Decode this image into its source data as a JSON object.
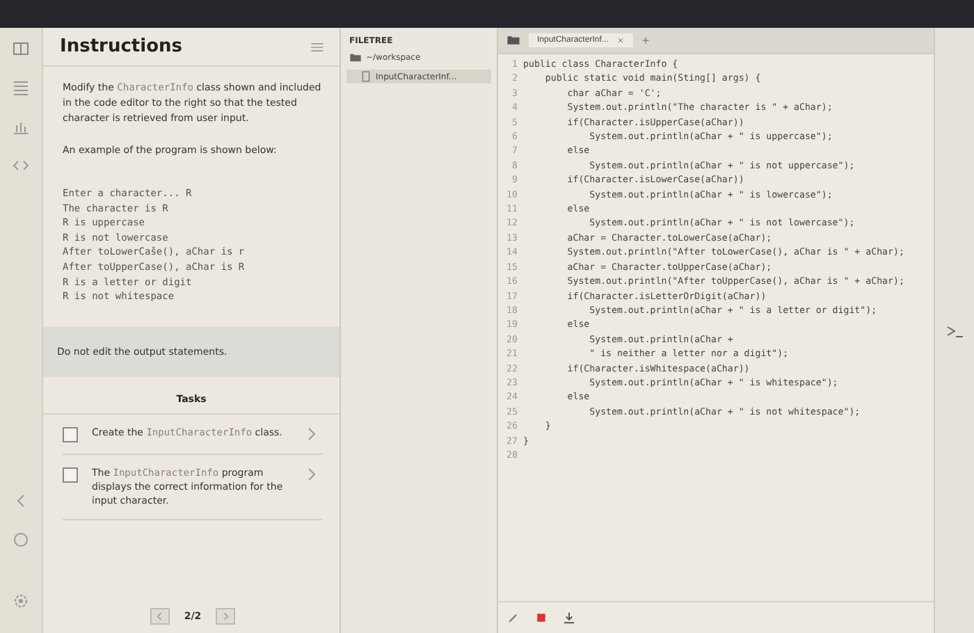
{
  "instructions": {
    "title": "Instructions",
    "paragraphs": [
      [
        {
          "text": "Modify the "
        },
        {
          "text": "CharacterInfo",
          "kind": "code"
        },
        {
          "text": " class shown and included in the code editor to the right so that the tested character is retrieved from user input."
        }
      ],
      [
        {
          "text": "An example of the program is shown below:"
        }
      ]
    ],
    "output_example": [
      "Enter a character... R",
      "The character is R",
      "R is uppercase",
      "R is not lowercase",
      "After toLowerCaše(), aChar is r",
      "After toUpperCase(), aChar is R",
      "R is a letter or digit",
      "R is not whitespace"
    ],
    "note": "Do not edit the output statements.",
    "tasks_title": "Tasks",
    "tasks": [
      {
        "checked": false,
        "text": [
          {
            "text": "Create the "
          },
          {
            "text": "InputCharacterInfo",
            "kind": "code"
          },
          {
            "text": " class."
          }
        ]
      },
      {
        "checked": false,
        "text": [
          {
            "text": "The "
          },
          {
            "text": "InputCharacterInfo",
            "kind": "code"
          },
          {
            "text": " program displays the correct information for the input character."
          }
        ]
      }
    ],
    "page": "2/2"
  },
  "filetree": {
    "title": "FILETREE",
    "folder": "~/workspace",
    "files": [
      {
        "name": "InputCharacterInf...",
        "selected": true
      }
    ]
  },
  "editor": {
    "tabs": [
      {
        "label": "InputCharacterInf...",
        "selected": true
      }
    ],
    "add_tab": "+",
    "lines": [
      {
        "number": "1",
        "code": "public class CharacterInfo {"
      },
      {
        "number": "2",
        "code": "    public static void main(Sting[] args) {"
      },
      {
        "number": "3",
        "code": "        char aChar = 'C';"
      },
      {
        "number": "4",
        "code": "        System.out.println(\"The character is \" + aChar);"
      },
      {
        "number": "5",
        "code": "        if(Character.isUpperCase(aChar))"
      },
      {
        "number": "6",
        "code": "            System.out.println(aChar + \" is uppercase\");"
      },
      {
        "number": "7",
        "code": "        else"
      },
      {
        "number": "8",
        "code": "            System.out.println(aChar + \" is not uppercase\");"
      },
      {
        "number": "9",
        "code": "        if(Character.isLowerCase(aChar))"
      },
      {
        "number": "10",
        "code": "            System.out.println(aChar + \" is lowercase\");"
      },
      {
        "number": "11",
        "code": "        else"
      },
      {
        "number": "12",
        "code": "            System.out.println(aChar + \" is not lowercase\");"
      },
      {
        "number": "13",
        "code": "        aChar = Character.toLowerCase(aChar);"
      },
      {
        "number": "14",
        "code": "        System.out.println(\"After toLowerCase(), aChar is \" + aChar);"
      },
      {
        "number": "15",
        "code": "        aChar = Character.toUpperCase(aChar);"
      },
      {
        "number": "16",
        "code": "        System.out.println(\"After toUpperCase(), aChar is \" + aChar);"
      },
      {
        "number": "17",
        "code": "        if(Character.isLetterOrDigit(aChar))"
      },
      {
        "number": "18",
        "code": "            System.out.println(aChar + \" is a letter or digit\");"
      },
      {
        "number": "19",
        "code": "        else"
      },
      {
        "number": "20",
        "code": "            System.out.println(aChar +"
      },
      {
        "number": "21",
        "code": "            \" is neither a letter nor a digit\");"
      },
      {
        "number": "22",
        "code": "        if(Character.isWhitespace(aChar))"
      },
      {
        "number": "23",
        "code": "            System.out.println(aChar + \" is whitespace\");"
      },
      {
        "number": "24",
        "code": "        else"
      },
      {
        "number": "25",
        "code": "            System.out.println(aChar + \" is not whitespace\");"
      },
      {
        "number": "26",
        "code": "    }"
      },
      {
        "number": "27",
        "code": "}"
      },
      {
        "number": "28"
      }
    ]
  }
}
